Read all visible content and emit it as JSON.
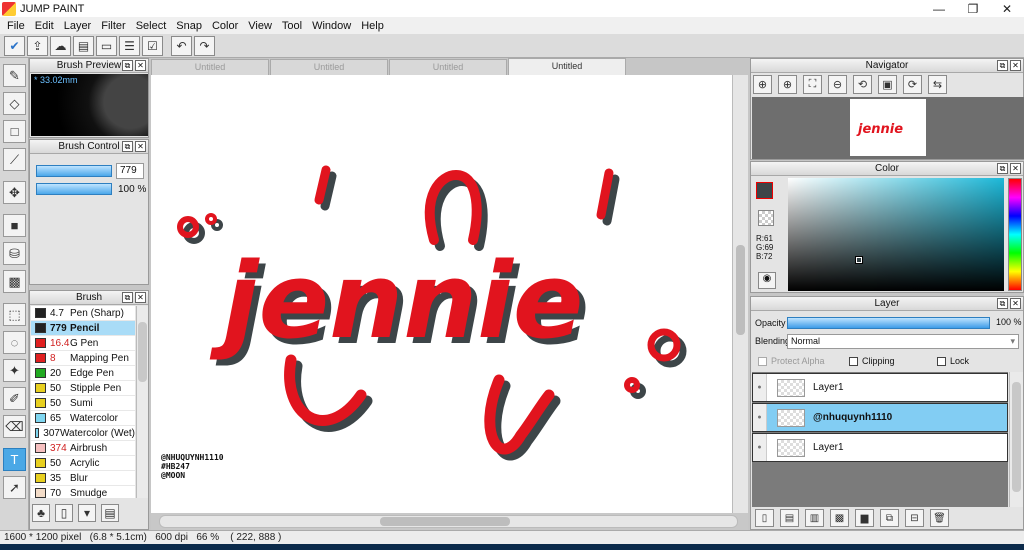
{
  "window": {
    "title": "JUMP PAINT",
    "controls": [
      "—",
      "❐",
      "✕"
    ]
  },
  "menu": [
    "File",
    "Edit",
    "Layer",
    "Filter",
    "Select",
    "Snap",
    "Color",
    "View",
    "Tool",
    "Window",
    "Help"
  ],
  "toolbar_icons": [
    "blue-check-icon",
    "export-icon",
    "comment-icon",
    "speech-icon",
    "page-icon",
    "list-icon",
    "checklist-icon",
    "undo-icon",
    "redo-icon"
  ],
  "tools": [
    "brush-icon",
    "eraser-icon",
    "rectangle-icon",
    "line-icon",
    "move-icon",
    "fill-rect-icon",
    "bucket-icon",
    "gradient-icon",
    "marquee-icon",
    "lasso-icon",
    "magic-wand-icon",
    "select-pen-icon",
    "select-eraser-icon",
    "text-icon",
    "pointer-icon"
  ],
  "brush_preview": {
    "title": "Brush Preview",
    "size_label": "* 33.02mm"
  },
  "brush_control": {
    "title": "Brush Control",
    "size_value": "779",
    "opacity_value": "100 %"
  },
  "brush_list": {
    "title": "Brush",
    "items": [
      {
        "size": "4.7",
        "name": "Pen (Sharp)",
        "color": "#222222",
        "selected": false
      },
      {
        "size": "779",
        "name": "Pencil",
        "color": "#222222",
        "selected": true
      },
      {
        "size": "16.4",
        "name": "G Pen",
        "color": "#e02020",
        "selected": false
      },
      {
        "size": "8",
        "name": "Mapping Pen",
        "color": "#e02020",
        "selected": false
      },
      {
        "size": "20",
        "name": "Edge Pen",
        "color": "#22aa22",
        "selected": false
      },
      {
        "size": "50",
        "name": "Stipple Pen",
        "color": "#e8d020",
        "selected": false
      },
      {
        "size": "50",
        "name": "Sumi",
        "color": "#e8d020",
        "selected": false
      },
      {
        "size": "65",
        "name": "Watercolor",
        "color": "#7fd6f0",
        "selected": false
      },
      {
        "size": "307",
        "name": "Watercolor (Wet)",
        "color": "#7fd6f0",
        "selected": false
      },
      {
        "size": "374",
        "name": "Airbrush",
        "color": "#f6c0c0",
        "selected": false
      },
      {
        "size": "50",
        "name": "Acrylic",
        "color": "#e8d020",
        "selected": false
      },
      {
        "size": "35",
        "name": "Blur",
        "color": "#e8d020",
        "selected": false
      },
      {
        "size": "70",
        "name": "Smudge",
        "color": "#f3dcc8",
        "selected": false
      }
    ]
  },
  "canvas": {
    "tabs": [
      {
        "label": "Untitled",
        "active": false
      },
      {
        "label": "Untitled",
        "active": false
      },
      {
        "label": "Untitled",
        "active": false
      },
      {
        "label": "Untitled",
        "active": true
      }
    ],
    "artwork_text": "jennie",
    "signature": [
      "@NHUQUYNH1110",
      "#HB247",
      "@MOON"
    ],
    "stroke_color": "#e1141e",
    "shadow_color": "#3d4548"
  },
  "navigator": {
    "title": "Navigator",
    "icons": [
      "zoom-fit-icon",
      "zoom-in-icon",
      "fit-screen-icon",
      "zoom-out-icon",
      "rotate-left-icon",
      "actual-size-icon",
      "rotate-right-icon",
      "flip-icon"
    ]
  },
  "color": {
    "title": "Color",
    "r": "R:61",
    "g": "G:69",
    "b": "B:72",
    "foreground": "#3d4548",
    "background": "#e1141e"
  },
  "layer": {
    "title": "Layer",
    "opacity_label": "Opacity",
    "opacity_value": "100 %",
    "blending_label": "Blending",
    "blending_value": "Normal",
    "protect_alpha": "Protect Alpha",
    "clipping": "Clipping",
    "lock": "Lock",
    "layers": [
      {
        "name": "Layer1",
        "selected": false
      },
      {
        "name": "@nhuquynh1110",
        "selected": true
      },
      {
        "name": "Layer1",
        "selected": false
      }
    ]
  },
  "status": {
    "text": "1600 * 1200 pixel   (6.8 * 5.1cm)   600 dpi   66 %    ( 222, 888 )"
  }
}
